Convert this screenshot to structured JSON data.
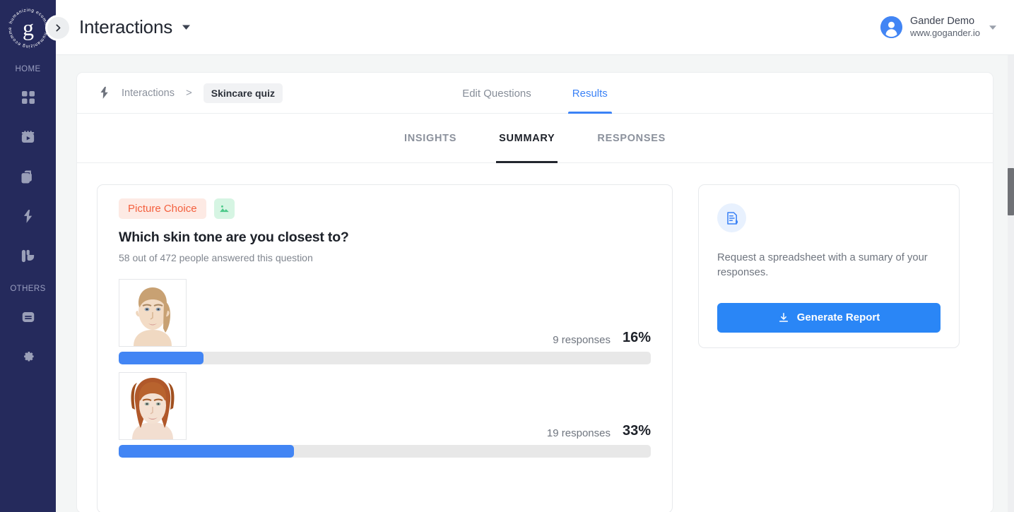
{
  "sidebar": {
    "logo": {
      "icon": "gander-logo-icon",
      "letter": "g",
      "ring_text": "humanizing ecommerce"
    },
    "collapse": {
      "icon": "chevron-right-icon"
    },
    "sections": [
      {
        "label": "HOME",
        "items": [
          {
            "icon": "grid-dashboard-icon",
            "name": "sidebar-item-dashboard"
          },
          {
            "icon": "video-player-icon",
            "name": "sidebar-item-videos"
          },
          {
            "icon": "documents-icon",
            "name": "sidebar-item-pages"
          },
          {
            "icon": "lightning-bolt-icon",
            "name": "sidebar-item-interactions"
          },
          {
            "icon": "palette-analytics-icon",
            "name": "sidebar-item-branding"
          }
        ]
      },
      {
        "label": "OTHERS",
        "items": [
          {
            "icon": "subtitles-card-icon",
            "name": "sidebar-item-captions"
          },
          {
            "icon": "gear-icon",
            "name": "sidebar-item-settings"
          }
        ]
      }
    ]
  },
  "topbar": {
    "title": "Interactions",
    "title_caret_icon": "caret-down-icon",
    "account": {
      "avatar_icon": "user-avatar-icon",
      "name": "Gander Demo",
      "url": "www.gogander.io",
      "caret_icon": "caret-down-icon"
    }
  },
  "breadcrumb": {
    "bolt_icon": "lightning-bolt-icon",
    "parent": "Interactions",
    "separator": ">",
    "current": "Skincare quiz"
  },
  "main_tabs": [
    {
      "label": "Edit Questions",
      "active": false
    },
    {
      "label": "Results",
      "active": true
    }
  ],
  "sub_tabs": [
    {
      "label": "INSIGHTS",
      "active": false
    },
    {
      "label": "SUMMARY",
      "active": true
    },
    {
      "label": "RESPONSES",
      "active": false
    }
  ],
  "question": {
    "type_badge": "Picture Choice",
    "type_icon": "image-icon",
    "title": "Which skin tone are you closest to?",
    "subtitle": "58 out of 472 people answered this question",
    "answered": 58,
    "total": 472
  },
  "report_panel": {
    "icon": "report-document-icon",
    "description": "Request a spreadsheet with a sumary of your responses.",
    "button_label": "Generate Report",
    "button_icon": "download-icon"
  },
  "scrollbar": {
    "name": "vertical-scrollbar"
  },
  "colors": {
    "sidebar_bg": "#252a5c",
    "accent_blue": "#3b82f6",
    "bar_blue": "#4285f4",
    "button_blue": "#2a86f6",
    "badge_orange_text": "#f4603e",
    "badge_orange_bg": "#fdeae4",
    "badge_green_icon": "#4cc98a",
    "badge_green_bg": "#d6f5e3",
    "page_bg": "#f4f6f6",
    "track_gray": "#e8e8e8"
  },
  "chart_data": {
    "type": "bar",
    "title": "Which skin tone are you closest to?",
    "xlabel": "",
    "ylabel": "",
    "categories": [
      "Skin tone option 1 (blonde, light)",
      "Skin tone option 2 (auburn, fair)"
    ],
    "values": [
      16,
      33
    ],
    "counts": [
      9,
      19
    ],
    "count_labels": [
      "9 responses",
      "19 responses"
    ],
    "value_labels": [
      "16%",
      "33%"
    ],
    "ylim": [
      0,
      100
    ],
    "grid": false,
    "legend": "none",
    "options": [
      {
        "label": "9 responses",
        "percent_label": "16%",
        "percent": 16,
        "count": 9,
        "thumb": "face-blonde-light"
      },
      {
        "label": "19 responses",
        "percent_label": "33%",
        "percent": 33,
        "count": 19,
        "thumb": "face-auburn-fair"
      }
    ]
  }
}
